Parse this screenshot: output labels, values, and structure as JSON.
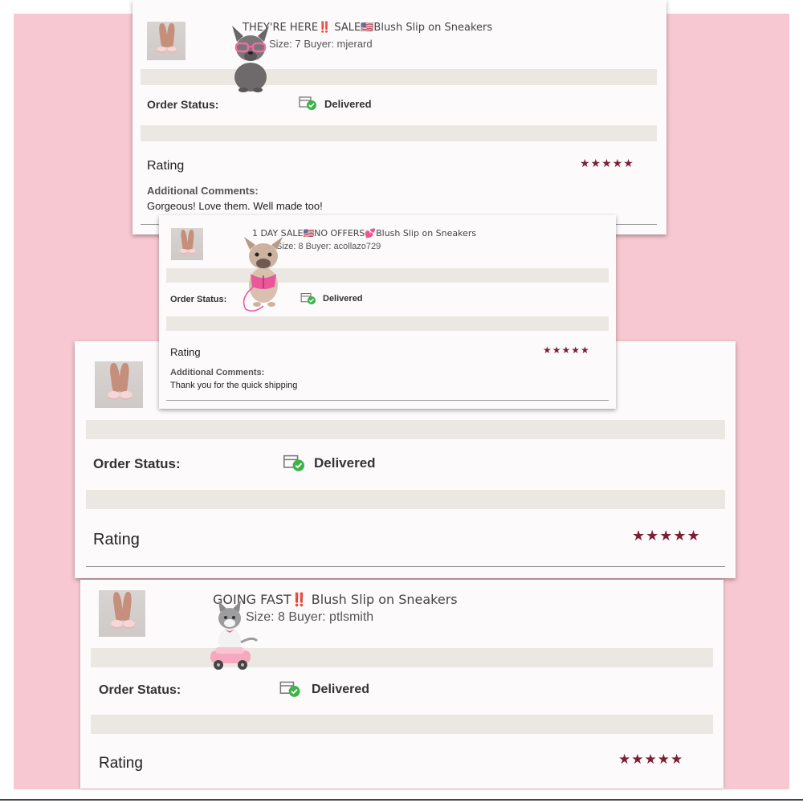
{
  "colors": {
    "background": "#f8c8d2",
    "card": "#fcfafb",
    "divider_band": "#ebe8e4",
    "star": "#7a1f35",
    "check": "#3cb44a"
  },
  "orders": [
    {
      "title": "THEY'RE HERE‼️ SALE🇺🇸Blush Slip on Sneakers",
      "size_buyer": "Size: 7  Buyer: mjerard",
      "status_label": "Order Status:",
      "status_value": "Delivered",
      "rating_label": "Rating",
      "stars": "★★★★★",
      "comments_label": "Additional Comments:",
      "comments_text": "Gorgeous! Love them. Well made too!",
      "sticker": "pink-glasses-bulldog-sticker"
    },
    {
      "title": "1 DAY SALE🇺🇸NO OFFERS💕Blush Slip on Sneakers",
      "size_buyer": "Size: 8  Buyer: acollazo729",
      "status_label": "Order Status:",
      "status_value": "Delivered",
      "rating_label": "Rating",
      "stars": "★★★★★",
      "comments_label": "Additional Comments:",
      "comments_text": "Thank you for the quick shipping",
      "sticker": "pink-harness-bulldog-sticker"
    },
    {
      "status_label": "Order Status:",
      "status_value": "Delivered",
      "rating_label": "Rating",
      "stars": "★★★★★"
    },
    {
      "title": "GOING FAST‼️ Blush Slip on Sneakers",
      "size_buyer": "Size: 8  Buyer: ptlsmith",
      "status_label": "Order Status:",
      "status_value": "Delivered",
      "rating_label": "Rating",
      "stars": "★★★★★",
      "sticker": "kitten-pink-car-sticker"
    }
  ]
}
